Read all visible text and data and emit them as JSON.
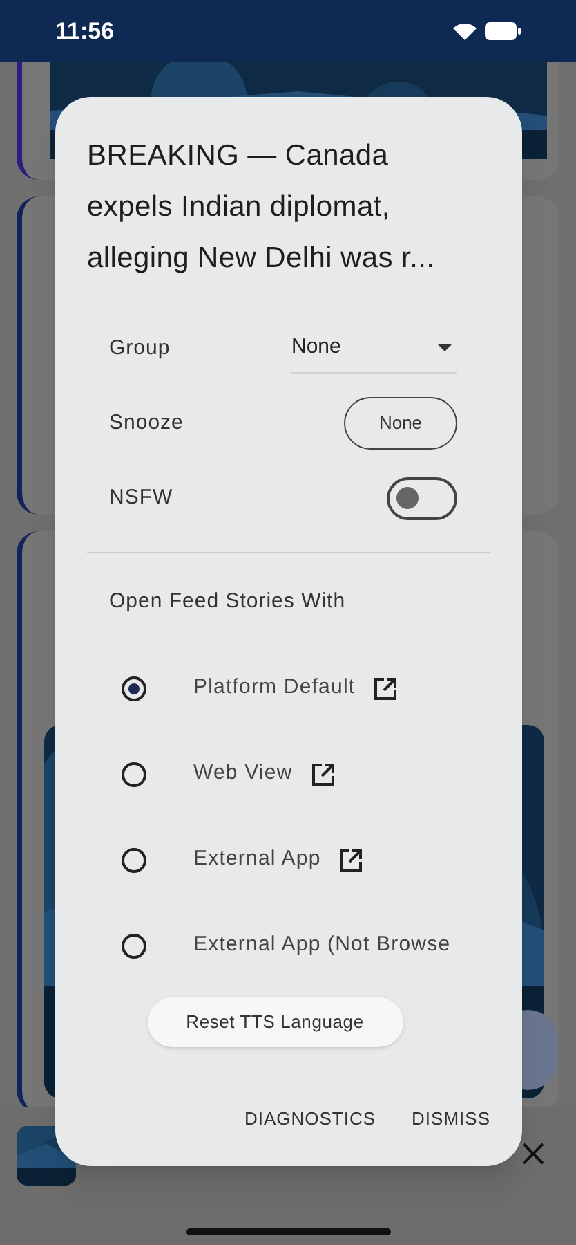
{
  "status_bar": {
    "time": "11:56"
  },
  "dialog": {
    "title": "BREAKING — Canada expels Indian diplomat, alleging New Delhi was r...",
    "settings": [
      {
        "kind": "dropdown",
        "label": "Group",
        "value": "None"
      },
      {
        "kind": "button",
        "label": "Snooze",
        "value": "None"
      },
      {
        "kind": "toggle",
        "label": "NSFW",
        "on": false
      }
    ],
    "open_with": {
      "heading": "Open Feed Stories With",
      "options": [
        {
          "label": "Platform Default",
          "selected": true,
          "link_icon": true
        },
        {
          "label": "Web View",
          "selected": false,
          "link_icon": true
        },
        {
          "label": "External App",
          "selected": false,
          "link_icon": true
        },
        {
          "label": "External App (Not Browse",
          "selected": false,
          "link_icon": false
        }
      ]
    },
    "reset_button": "Reset TTS Language",
    "actions": [
      "DIAGNOSTICS",
      "DISMISS"
    ]
  }
}
